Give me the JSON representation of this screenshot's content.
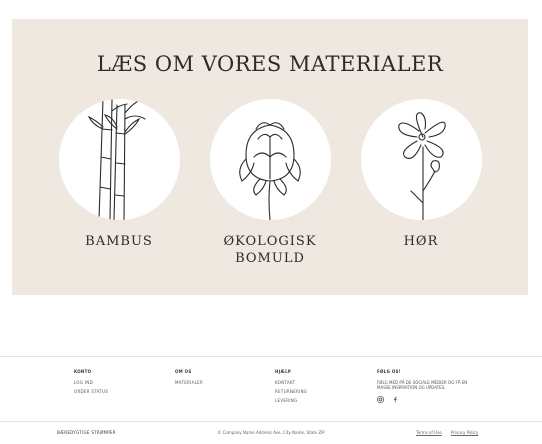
{
  "panel": {
    "title": "LÆS OM VORES MATERIALER",
    "materials": [
      {
        "name": "BAMBUS",
        "illustration": "bamboo-illustration"
      },
      {
        "name": "ØKOLOGISK BOMULD",
        "illustration": "cotton-illustration"
      },
      {
        "name": "HØR",
        "illustration": "flax-flower-illustration"
      }
    ]
  },
  "footer": {
    "columns": [
      {
        "heading": "KONTO",
        "links": [
          "LOG IND",
          "ORDER STATUS"
        ]
      },
      {
        "heading": "OM OS",
        "links": [
          "MATERIALER"
        ]
      },
      {
        "heading": "HJÆLP",
        "links": [
          "KONTAKT",
          "RETURNERING",
          "LEVERING"
        ]
      }
    ],
    "follow": {
      "heading": "FØLG OS!",
      "text": "FØLG MED PÅ DE SOCIALE MEDIER OG FÅ EN MASSE INSPIRATION OG UPDATES.",
      "icons": [
        "instagram-icon",
        "facebook-icon"
      ]
    },
    "bottom": {
      "logo": "BÆREDYGTIGE STRØMPER",
      "copyright": "© Company Name Address Ave, City Name, State ZIP",
      "links": [
        "Terms of Use",
        "Privacy Policy"
      ]
    }
  }
}
